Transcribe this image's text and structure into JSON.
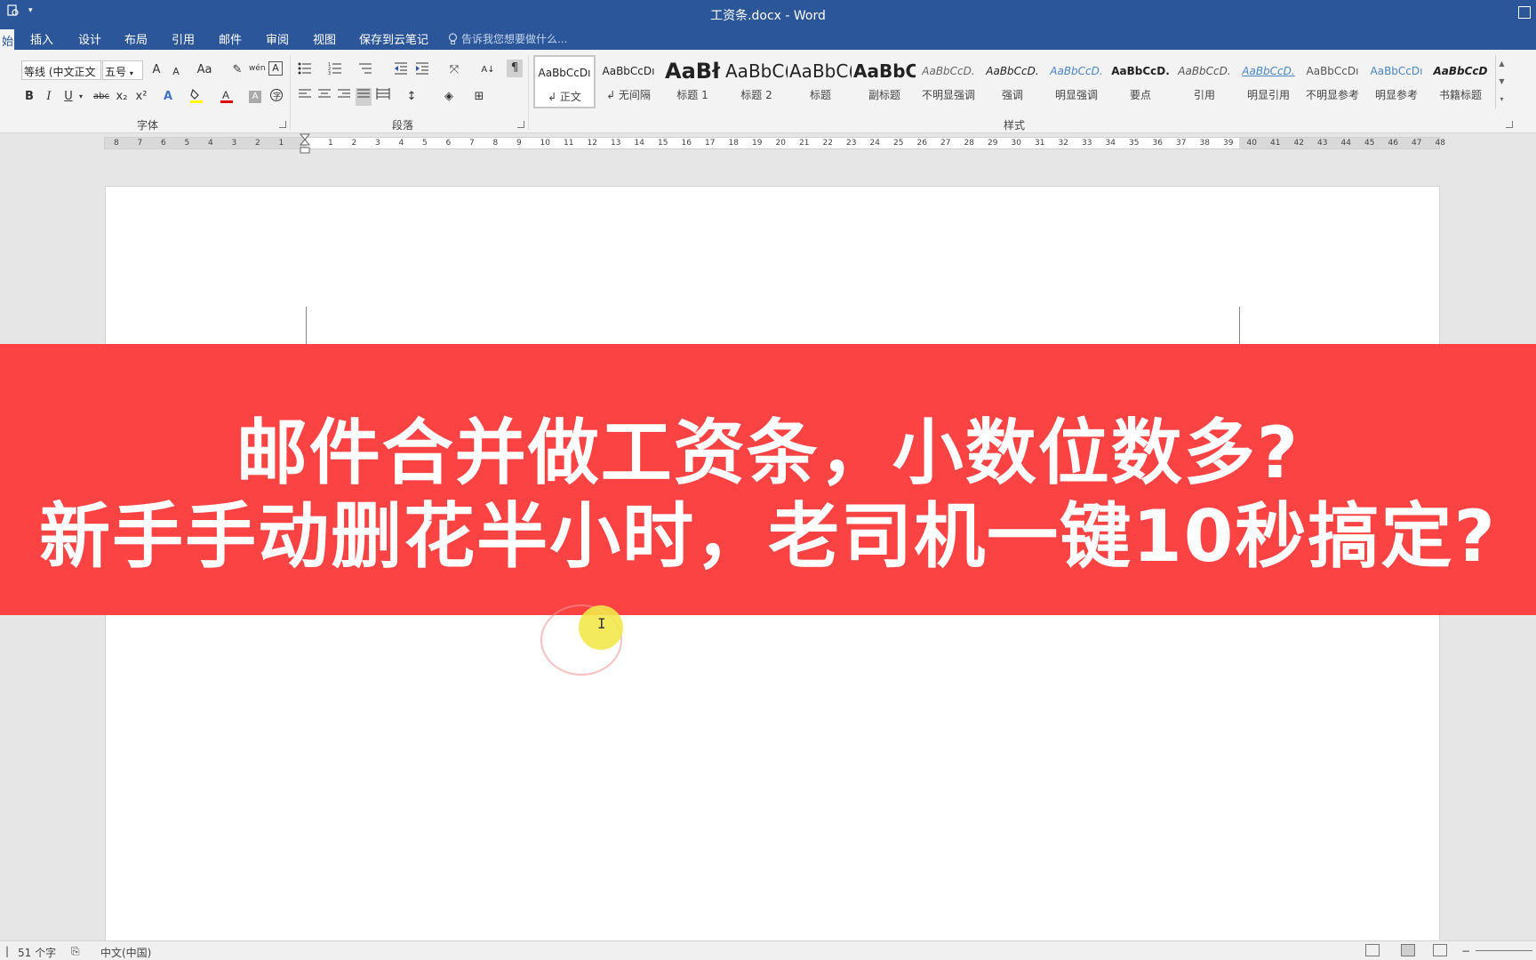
{
  "window": {
    "title": "工资条.docx - Word"
  },
  "tabs": [
    {
      "label": "插入"
    },
    {
      "label": "设计"
    },
    {
      "label": "布局"
    },
    {
      "label": "引用"
    },
    {
      "label": "邮件"
    },
    {
      "label": "审阅"
    },
    {
      "label": "视图"
    },
    {
      "label": "保存到云笔记"
    }
  ],
  "tell_me": {
    "placeholder": "告诉我您想要做什么..."
  },
  "font_group": {
    "label": "字体",
    "font_name": "等线 (中文正文",
    "font_size": "五号",
    "grow": "A",
    "shrink": "A",
    "case": "Aa",
    "phonetic": "wén",
    "bold": "B",
    "italic": "I",
    "underline": "U",
    "strike": "abc",
    "subscript": "x₂",
    "superscript": "x²"
  },
  "paragraph_group": {
    "label": "段落"
  },
  "styles_group": {
    "label": "样式",
    "items": [
      {
        "preview": "AaBbCcDı",
        "name": "↲ 正文",
        "selected": true
      },
      {
        "preview": "AaBbCcDı",
        "name": "↲ 无间隔"
      },
      {
        "preview": "AaBł",
        "name": "标题 1"
      },
      {
        "preview": "AaBbC(",
        "name": "标题 2"
      },
      {
        "preview": "AaBbC(",
        "name": "标题"
      },
      {
        "preview": "AaBbC(",
        "name": "副标题"
      },
      {
        "preview": "AaBbCcD.",
        "name": "不明显强调"
      },
      {
        "preview": "AaBbCcD.",
        "name": "强调"
      },
      {
        "preview": "AaBbCcD.",
        "name": "明显强调"
      },
      {
        "preview": "AaBbCcD.",
        "name": "要点"
      },
      {
        "preview": "AaBbCcD.",
        "name": "引用"
      },
      {
        "preview": "AaBbCcD.",
        "name": "明显引用"
      },
      {
        "preview": "AaBbCcDı",
        "name": "不明显参考"
      },
      {
        "preview": "AaBbCcDı",
        "name": "明显参考"
      },
      {
        "preview": "AaBbCcD",
        "name": "书籍标题"
      }
    ]
  },
  "ruler": {
    "left_numbers": [
      "8",
      "7",
      "6",
      "5",
      "4",
      "3",
      "2",
      "1"
    ],
    "right_numbers": [
      "1",
      "2",
      "3",
      "4",
      "5",
      "6",
      "7",
      "8",
      "9",
      "10",
      "11",
      "12",
      "13",
      "14",
      "15",
      "16",
      "17",
      "18",
      "19",
      "20",
      "21",
      "22",
      "23",
      "24",
      "25",
      "26",
      "27",
      "28",
      "29",
      "30",
      "31",
      "32",
      "33",
      "34",
      "35",
      "36",
      "37",
      "38",
      "39",
      "40",
      "41",
      "42",
      "43",
      "44",
      "45",
      "46",
      "47",
      "48"
    ]
  },
  "banner": {
    "line1": "邮件合并做工资条，小数位数多?",
    "line2": "新手手动删花半小时，老司机一键10秒搞定?"
  },
  "status": {
    "word_count": "51 个字",
    "language": "中文(中国)"
  },
  "colors": {
    "word_blue": "#2b579a",
    "banner_red": "#fc4343",
    "ribbon_bg": "#f3f3f3"
  }
}
